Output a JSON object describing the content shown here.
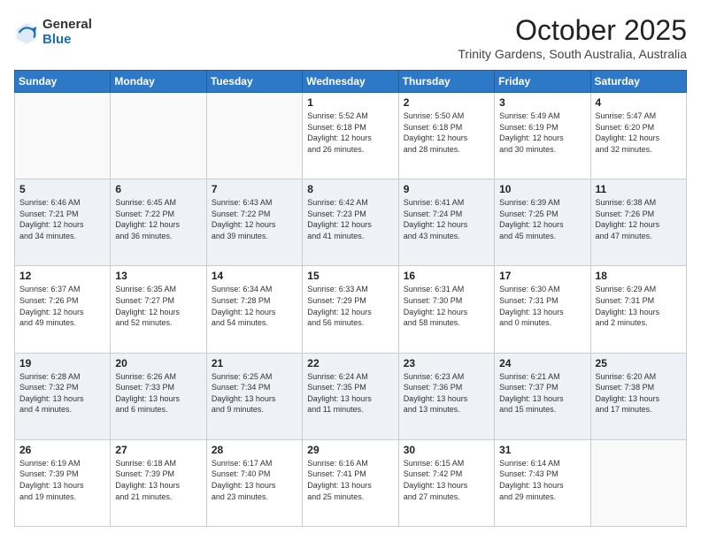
{
  "logo": {
    "general": "General",
    "blue": "Blue"
  },
  "header": {
    "month": "October 2025",
    "location": "Trinity Gardens, South Australia, Australia"
  },
  "weekdays": [
    "Sunday",
    "Monday",
    "Tuesday",
    "Wednesday",
    "Thursday",
    "Friday",
    "Saturday"
  ],
  "weeks": [
    [
      {
        "day": "",
        "info": ""
      },
      {
        "day": "",
        "info": ""
      },
      {
        "day": "",
        "info": ""
      },
      {
        "day": "1",
        "info": "Sunrise: 5:52 AM\nSunset: 6:18 PM\nDaylight: 12 hours\nand 26 minutes."
      },
      {
        "day": "2",
        "info": "Sunrise: 5:50 AM\nSunset: 6:18 PM\nDaylight: 12 hours\nand 28 minutes."
      },
      {
        "day": "3",
        "info": "Sunrise: 5:49 AM\nSunset: 6:19 PM\nDaylight: 12 hours\nand 30 minutes."
      },
      {
        "day": "4",
        "info": "Sunrise: 5:47 AM\nSunset: 6:20 PM\nDaylight: 12 hours\nand 32 minutes."
      }
    ],
    [
      {
        "day": "5",
        "info": "Sunrise: 6:46 AM\nSunset: 7:21 PM\nDaylight: 12 hours\nand 34 minutes."
      },
      {
        "day": "6",
        "info": "Sunrise: 6:45 AM\nSunset: 7:22 PM\nDaylight: 12 hours\nand 36 minutes."
      },
      {
        "day": "7",
        "info": "Sunrise: 6:43 AM\nSunset: 7:22 PM\nDaylight: 12 hours\nand 39 minutes."
      },
      {
        "day": "8",
        "info": "Sunrise: 6:42 AM\nSunset: 7:23 PM\nDaylight: 12 hours\nand 41 minutes."
      },
      {
        "day": "9",
        "info": "Sunrise: 6:41 AM\nSunset: 7:24 PM\nDaylight: 12 hours\nand 43 minutes."
      },
      {
        "day": "10",
        "info": "Sunrise: 6:39 AM\nSunset: 7:25 PM\nDaylight: 12 hours\nand 45 minutes."
      },
      {
        "day": "11",
        "info": "Sunrise: 6:38 AM\nSunset: 7:26 PM\nDaylight: 12 hours\nand 47 minutes."
      }
    ],
    [
      {
        "day": "12",
        "info": "Sunrise: 6:37 AM\nSunset: 7:26 PM\nDaylight: 12 hours\nand 49 minutes."
      },
      {
        "day": "13",
        "info": "Sunrise: 6:35 AM\nSunset: 7:27 PM\nDaylight: 12 hours\nand 52 minutes."
      },
      {
        "day": "14",
        "info": "Sunrise: 6:34 AM\nSunset: 7:28 PM\nDaylight: 12 hours\nand 54 minutes."
      },
      {
        "day": "15",
        "info": "Sunrise: 6:33 AM\nSunset: 7:29 PM\nDaylight: 12 hours\nand 56 minutes."
      },
      {
        "day": "16",
        "info": "Sunrise: 6:31 AM\nSunset: 7:30 PM\nDaylight: 12 hours\nand 58 minutes."
      },
      {
        "day": "17",
        "info": "Sunrise: 6:30 AM\nSunset: 7:31 PM\nDaylight: 13 hours\nand 0 minutes."
      },
      {
        "day": "18",
        "info": "Sunrise: 6:29 AM\nSunset: 7:31 PM\nDaylight: 13 hours\nand 2 minutes."
      }
    ],
    [
      {
        "day": "19",
        "info": "Sunrise: 6:28 AM\nSunset: 7:32 PM\nDaylight: 13 hours\nand 4 minutes."
      },
      {
        "day": "20",
        "info": "Sunrise: 6:26 AM\nSunset: 7:33 PM\nDaylight: 13 hours\nand 6 minutes."
      },
      {
        "day": "21",
        "info": "Sunrise: 6:25 AM\nSunset: 7:34 PM\nDaylight: 13 hours\nand 9 minutes."
      },
      {
        "day": "22",
        "info": "Sunrise: 6:24 AM\nSunset: 7:35 PM\nDaylight: 13 hours\nand 11 minutes."
      },
      {
        "day": "23",
        "info": "Sunrise: 6:23 AM\nSunset: 7:36 PM\nDaylight: 13 hours\nand 13 minutes."
      },
      {
        "day": "24",
        "info": "Sunrise: 6:21 AM\nSunset: 7:37 PM\nDaylight: 13 hours\nand 15 minutes."
      },
      {
        "day": "25",
        "info": "Sunrise: 6:20 AM\nSunset: 7:38 PM\nDaylight: 13 hours\nand 17 minutes."
      }
    ],
    [
      {
        "day": "26",
        "info": "Sunrise: 6:19 AM\nSunset: 7:39 PM\nDaylight: 13 hours\nand 19 minutes."
      },
      {
        "day": "27",
        "info": "Sunrise: 6:18 AM\nSunset: 7:39 PM\nDaylight: 13 hours\nand 21 minutes."
      },
      {
        "day": "28",
        "info": "Sunrise: 6:17 AM\nSunset: 7:40 PM\nDaylight: 13 hours\nand 23 minutes."
      },
      {
        "day": "29",
        "info": "Sunrise: 6:16 AM\nSunset: 7:41 PM\nDaylight: 13 hours\nand 25 minutes."
      },
      {
        "day": "30",
        "info": "Sunrise: 6:15 AM\nSunset: 7:42 PM\nDaylight: 13 hours\nand 27 minutes."
      },
      {
        "day": "31",
        "info": "Sunrise: 6:14 AM\nSunset: 7:43 PM\nDaylight: 13 hours\nand 29 minutes."
      },
      {
        "day": "",
        "info": ""
      }
    ]
  ]
}
